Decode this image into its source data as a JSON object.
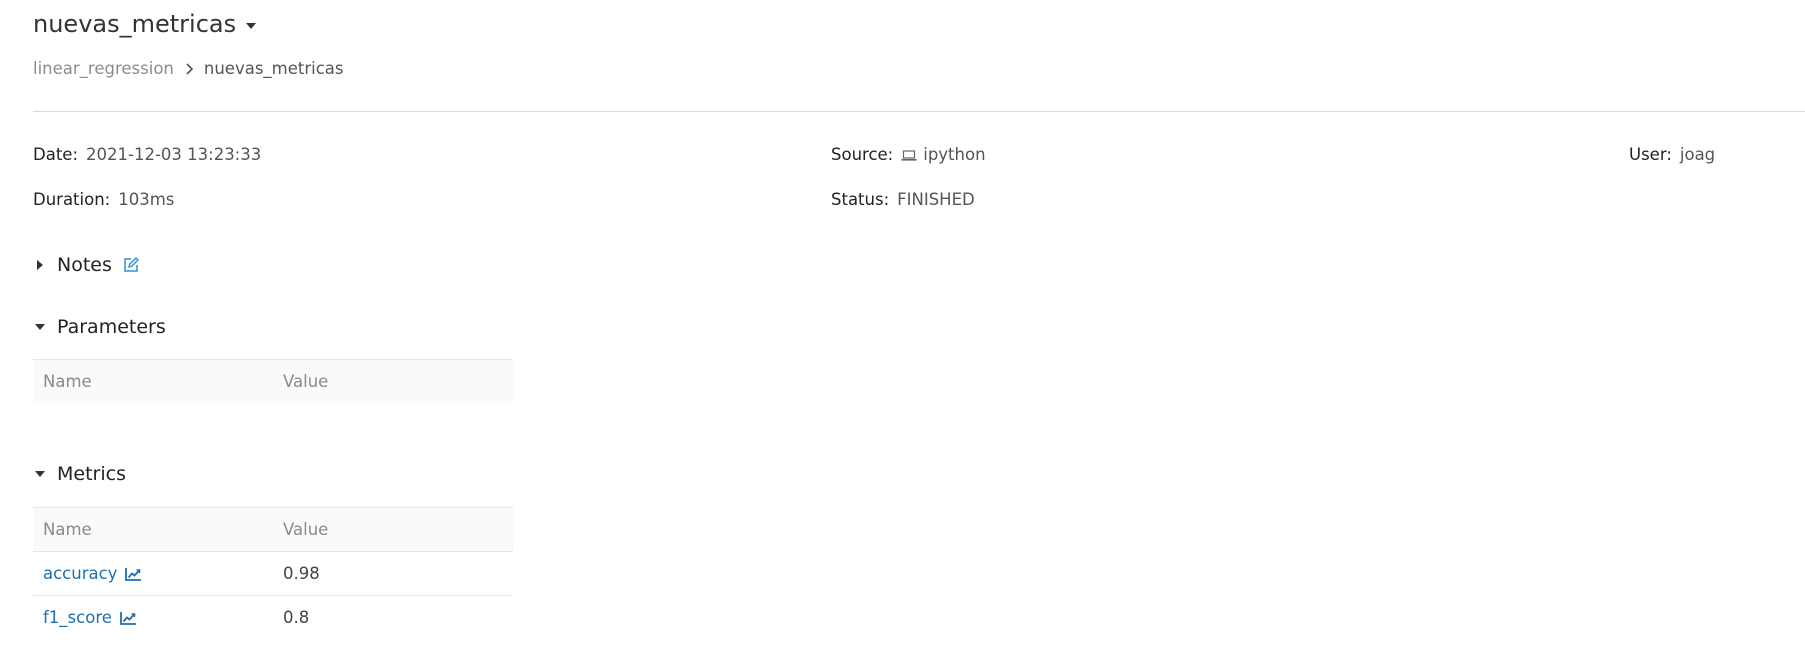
{
  "header": {
    "title": "nuevas_metricas",
    "breadcrumb": {
      "parent": "linear_regression",
      "current": "nuevas_metricas"
    }
  },
  "meta": {
    "date_label": "Date",
    "date_value": "2021-12-03 13:23:33",
    "source_label": "Source",
    "source_value": "ipython",
    "user_label": "User",
    "user_value": "joag",
    "duration_label": "Duration",
    "duration_value": "103ms",
    "status_label": "Status",
    "status_value": "FINISHED"
  },
  "sections": {
    "notes": "Notes",
    "parameters": "Parameters",
    "metrics": "Metrics"
  },
  "parameters_table": {
    "headers": [
      "Name",
      "Value"
    ],
    "rows": []
  },
  "metrics_table": {
    "headers": [
      "Name",
      "Value"
    ],
    "rows": [
      {
        "name": "accuracy",
        "value": "0.98"
      },
      {
        "name": "f1_score",
        "value": "0.8"
      }
    ]
  },
  "icons": {
    "source": "laptop-icon",
    "notes_edit": "edit-icon",
    "metric_chart": "line-chart-icon"
  },
  "colors": {
    "link": "#1f6fb0",
    "edit_icon": "#2d8fd5"
  }
}
